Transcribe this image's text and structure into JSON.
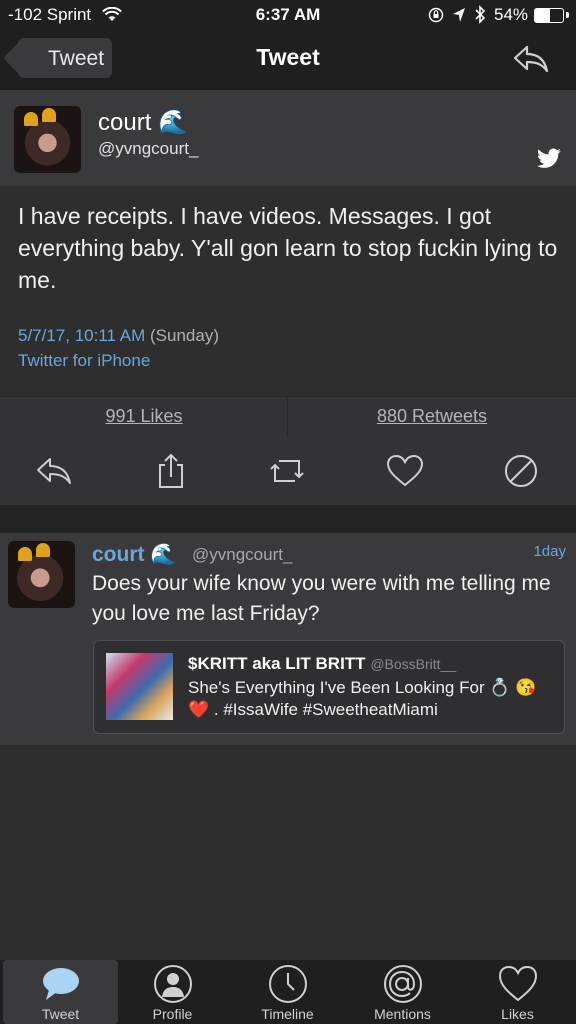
{
  "status_bar": {
    "carrier": "-102 Sprint",
    "time": "6:37 AM",
    "battery": "54%"
  },
  "nav": {
    "back_label": "Tweet",
    "title": "Tweet"
  },
  "tweet": {
    "author_name": "court 🌊",
    "author_handle": "@yvngcourt_",
    "text": "I have receipts. I have videos. Messages. I got everything baby. Y'all gon learn to stop fuckin lying to me.",
    "date": "5/7/17, 10:11 AM",
    "day": "(Sunday)",
    "source": "Twitter for iPhone",
    "likes": "991 Likes",
    "retweets": "880 Retweets"
  },
  "reply": {
    "author_name": "court 🌊",
    "author_handle": "@yvngcourt_",
    "time": "1day",
    "text": "Does your wife know you were with me telling me you love me last Friday?",
    "quote": {
      "name": "$KRITT aka LIT BRITT",
      "handle": "@BossBritt__",
      "text": "She's Everything I've Been Looking For 💍 😘 ❤️ . #IssaWife #SweetheatMiami"
    }
  },
  "tabs": [
    {
      "label": "Tweet",
      "icon": "speech-bubble-icon",
      "active": true
    },
    {
      "label": "Profile",
      "icon": "person-icon",
      "active": false
    },
    {
      "label": "Timeline",
      "icon": "clock-icon",
      "active": false
    },
    {
      "label": "Mentions",
      "icon": "at-sign-icon",
      "active": false
    },
    {
      "label": "Likes",
      "icon": "heart-icon",
      "active": false
    }
  ],
  "colors": {
    "accent": "#6aa6dc",
    "background": "#2e2e2f",
    "bar": "#1f1f20"
  }
}
